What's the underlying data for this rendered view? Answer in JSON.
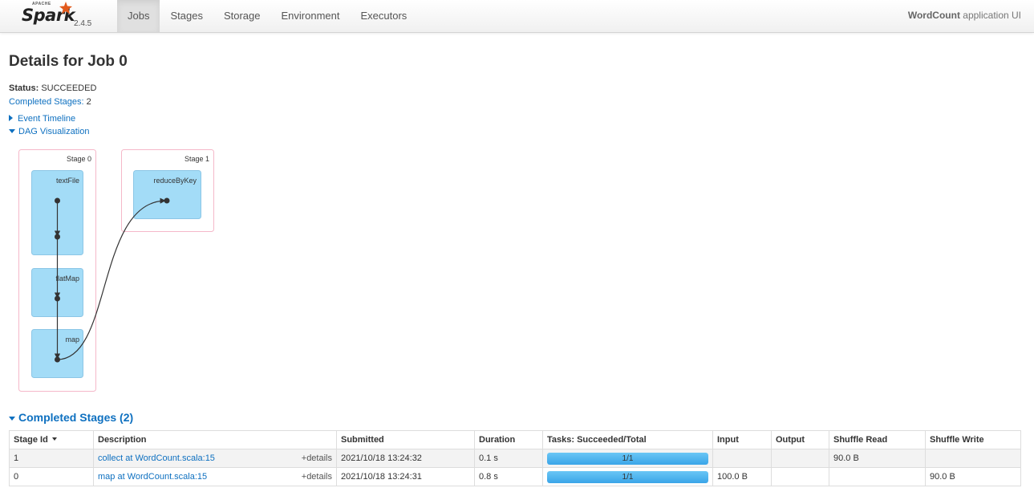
{
  "brand": {
    "apache": "APACHE",
    "name": "Spark",
    "version": "2.4.5"
  },
  "nav": {
    "items": [
      {
        "label": "Jobs",
        "active": true
      },
      {
        "label": "Stages",
        "active": false
      },
      {
        "label": "Storage",
        "active": false
      },
      {
        "label": "Environment",
        "active": false
      },
      {
        "label": "Executors",
        "active": false
      }
    ],
    "app_name": "WordCount",
    "app_suffix": " application UI"
  },
  "page": {
    "title": "Details for Job 0",
    "status_label": "Status:",
    "status_value": " SUCCEEDED",
    "completed_label": "Completed Stages:",
    "completed_value": " 2",
    "event_timeline": "Event Timeline",
    "dag_visualization": "DAG Visualization"
  },
  "dag": {
    "stages": [
      {
        "label": "Stage 0",
        "ops": [
          "textFile",
          "flatMap",
          "map"
        ]
      },
      {
        "label": "Stage 1",
        "ops": [
          "reduceByKey"
        ]
      }
    ]
  },
  "completed_stages": {
    "title": "Completed Stages (2)",
    "headers": [
      "Stage Id",
      "Description",
      "Submitted",
      "Duration",
      "Tasks: Succeeded/Total",
      "Input",
      "Output",
      "Shuffle Read",
      "Shuffle Write"
    ],
    "rows": [
      {
        "id": "1",
        "description": "collect at WordCount.scala:15",
        "details": "+details",
        "submitted": "2021/10/18 13:24:32",
        "duration": "0.1 s",
        "tasks": "1/1",
        "tasks_fraction": 1.0,
        "input": "",
        "output": "",
        "shuffle_read": "90.0 B",
        "shuffle_write": ""
      },
      {
        "id": "0",
        "description": "map at WordCount.scala:15",
        "details": "+details",
        "submitted": "2021/10/18 13:24:31",
        "duration": "0.8 s",
        "tasks": "1/1",
        "tasks_fraction": 1.0,
        "input": "100.0 B",
        "output": "",
        "shuffle_read": "",
        "shuffle_write": "90.0 B"
      }
    ]
  },
  "colors": {
    "link": "#0e70c0",
    "dag_node": "#a3dcf7",
    "dag_cluster_border": "#f5b8c9",
    "progress": "#3aa5e8"
  }
}
